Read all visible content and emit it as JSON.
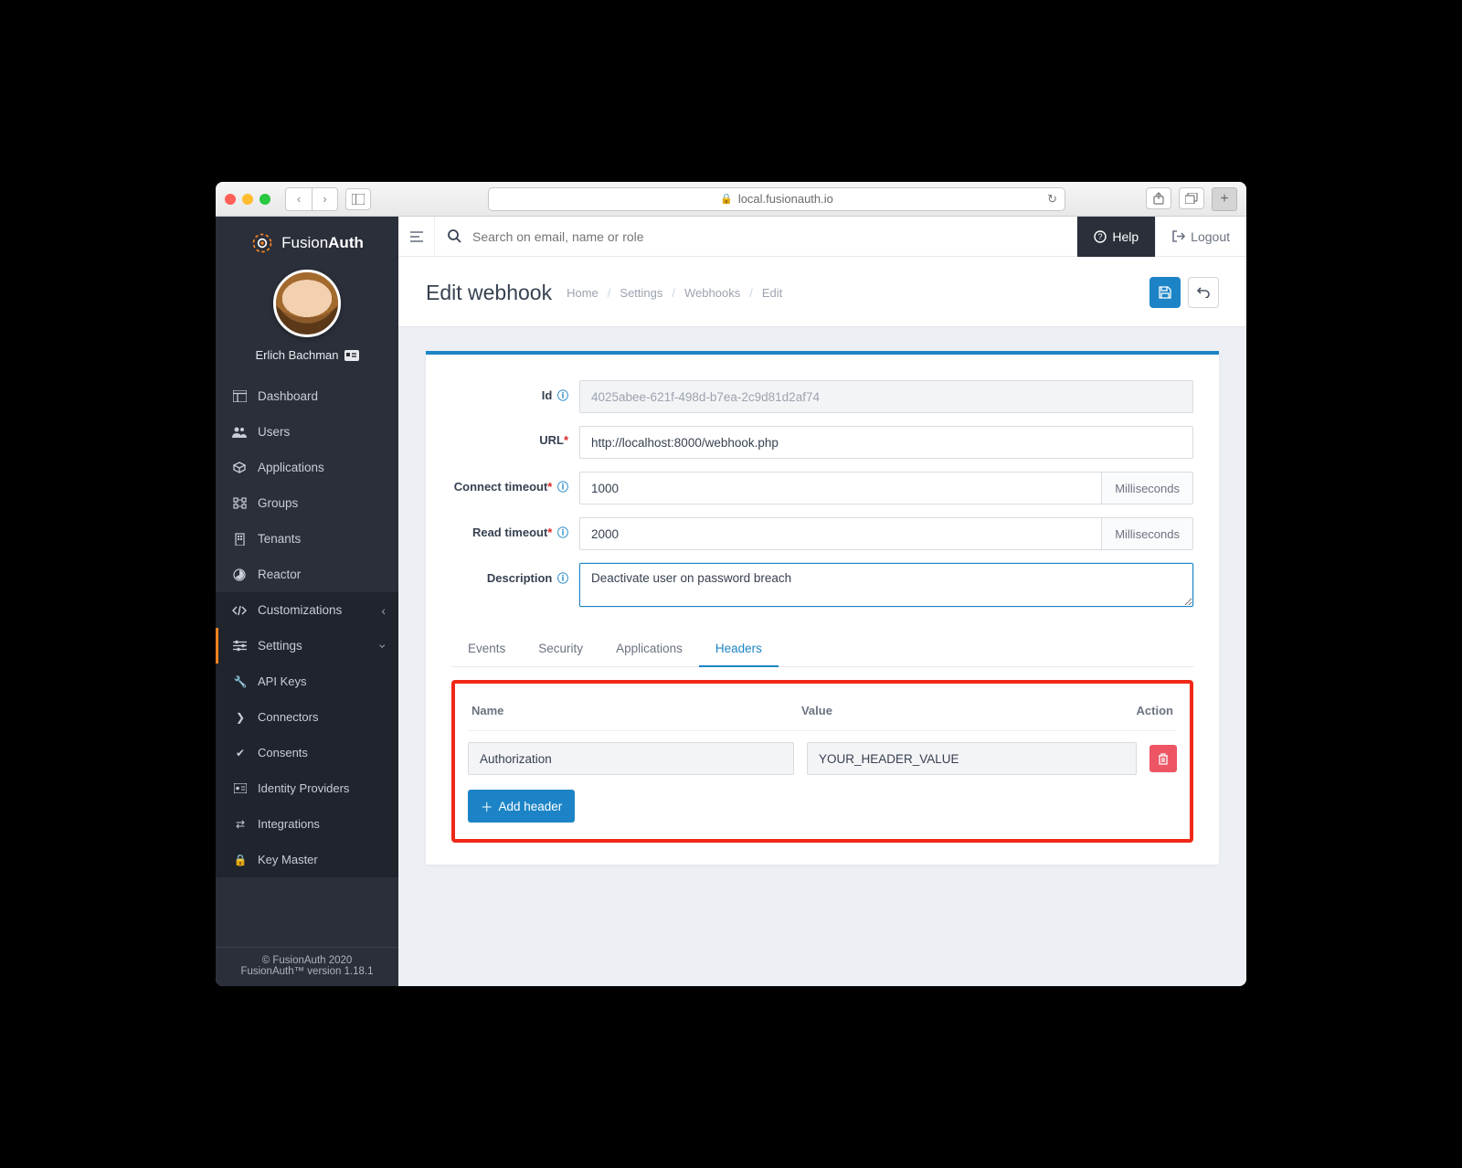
{
  "browser": {
    "url": "local.fusionauth.io"
  },
  "brand": {
    "name_a": "Fusion",
    "name_b": "Auth"
  },
  "user": {
    "name": "Erlich Bachman"
  },
  "sidebar": {
    "items": [
      {
        "label": "Dashboard"
      },
      {
        "label": "Users"
      },
      {
        "label": "Applications"
      },
      {
        "label": "Groups"
      },
      {
        "label": "Tenants"
      },
      {
        "label": "Reactor"
      },
      {
        "label": "Customizations"
      },
      {
        "label": "Settings"
      }
    ],
    "settings_sub": [
      {
        "label": "API Keys"
      },
      {
        "label": "Connectors"
      },
      {
        "label": "Consents"
      },
      {
        "label": "Identity Providers"
      },
      {
        "label": "Integrations"
      },
      {
        "label": "Key Master"
      }
    ]
  },
  "footer": {
    "copyright": "© FusionAuth 2020",
    "version": "FusionAuth™ version 1.18.1"
  },
  "topbar": {
    "search_placeholder": "Search on email, name or role",
    "help": "Help",
    "logout": "Logout"
  },
  "page": {
    "title": "Edit webhook",
    "breadcrumb": [
      "Home",
      "Settings",
      "Webhooks",
      "Edit"
    ]
  },
  "form": {
    "id_label": "Id",
    "id_value": "4025abee-621f-498d-b7ea-2c9d81d2af74",
    "url_label": "URL",
    "url_value": "http://localhost:8000/webhook.php",
    "connect_label": "Connect timeout",
    "connect_value": "1000",
    "read_label": "Read timeout",
    "read_value": "2000",
    "timeout_unit": "Milliseconds",
    "desc_label": "Description",
    "desc_value": "Deactivate user on password breach"
  },
  "tabs": [
    "Events",
    "Security",
    "Applications",
    "Headers"
  ],
  "headers_table": {
    "cols": {
      "name": "Name",
      "value": "Value",
      "action": "Action"
    },
    "rows": [
      {
        "name": "Authorization",
        "value": "YOUR_HEADER_VALUE"
      }
    ],
    "add_label": "Add header"
  }
}
